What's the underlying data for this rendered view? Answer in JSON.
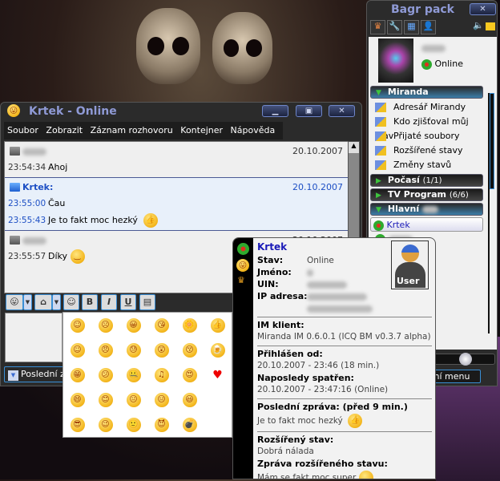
{
  "chat_window": {
    "title": "Krtek - Online",
    "menu": [
      "Soubor",
      "Zobrazit",
      "Záznam rozhovoru",
      "Kontejner",
      "Nápověda"
    ],
    "messages": [
      {
        "sender": "",
        "date": "20.10.2007",
        "mine": false,
        "lines": [
          {
            "time": "23:54:34",
            "text": "Ahoj",
            "emoticon": ""
          }
        ]
      },
      {
        "sender": "Krtek:",
        "date": "20.10.2007",
        "mine": true,
        "lines": [
          {
            "time": "23:55:00",
            "text": "Čau",
            "emoticon": ""
          },
          {
            "time": "23:55:43",
            "text": "Je to fakt moc hezký",
            "emoticon": "thumbs-up"
          }
        ]
      },
      {
        "sender": "",
        "date": "20.10.2007",
        "mine": false,
        "lines": [
          {
            "time": "23:55:57",
            "text": "Díky",
            "emoticon": "smile"
          }
        ]
      }
    ],
    "toolbar": {
      "bold": "B",
      "italic": "I",
      "underline": "U"
    },
    "bottom_button": "Poslední z"
  },
  "contact_list": {
    "title": "Bagr pack",
    "status": "Online",
    "groups": [
      {
        "name": "Miranda",
        "count": "",
        "open": true,
        "items": [
          "Adresář Mirandy",
          "Kdo zjišťoval můj stav",
          "Přijaté soubory",
          "Rozšířené stavy",
          "Změny stavů"
        ]
      },
      {
        "name": "Počasí",
        "count": "(1/1)",
        "open": false,
        "items": []
      },
      {
        "name": "TV Program",
        "count": "(6/6)",
        "open": false,
        "items": []
      },
      {
        "name": "Hlavní",
        "count": "",
        "open": true,
        "items": []
      }
    ],
    "selected_contact": "Krtek",
    "main_menu_button": "vní menu"
  },
  "tooltip": {
    "name": "Krtek",
    "fields": {
      "stav_label": "Stav:",
      "stav": "Online",
      "jmeno_label": "Jméno:",
      "uin_label": "UIN:",
      "ip_label": "IP adresa:"
    },
    "avatar_label": "User",
    "im_klient_label": "IM klient:",
    "im_klient": "Miranda IM 0.6.0.1 (ICQ BM  v0.3.7 alpha)",
    "prihlasen_label": "Přihlášen od:",
    "prihlasen": "20.10.2007 - 23:46 (18 min.)",
    "naposledy_label": "Naposledy spatřen:",
    "naposledy": "20.10.2007 - 23:47:16 (Online)",
    "posledni_label": "Poslední zpráva: (před 9 min.)",
    "posledni": "Je to fakt moc hezký",
    "rozsireny_label": "Rozšířený stav:",
    "rozsireny": "Dobrá nálada",
    "zprava_label": "Zpráva rozšířeného stavu:",
    "zprava": "Mám se fakt moc super"
  },
  "emoticons": [
    "☺",
    "☹",
    "😀",
    "😘",
    "🌼",
    "👍",
    "☺",
    "😠",
    "😓",
    "😲",
    "😚",
    "🍺",
    "😁",
    "😕",
    "🤐",
    "♫",
    "😍",
    "♥",
    "😄",
    "😊",
    "😐",
    "😑",
    "😃",
    "",
    "😎",
    "😉",
    "🙂",
    "😈",
    "💣",
    ""
  ],
  "colors": {
    "accent": "#1d4fc4",
    "title": "#8f9ad6"
  }
}
